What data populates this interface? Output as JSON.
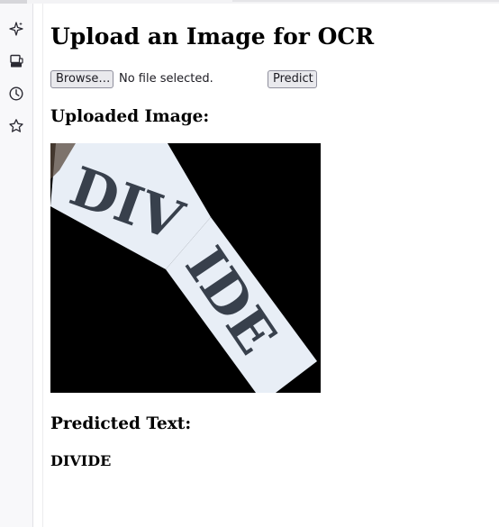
{
  "page": {
    "title": "Upload an Image for OCR"
  },
  "file_input": {
    "browse_label": "Browse…",
    "status_text": "No file selected."
  },
  "predict_button": {
    "label": "Predict"
  },
  "uploaded_section": {
    "heading": "Uploaded Image:",
    "image_word": "DIVIDE"
  },
  "predicted_section": {
    "heading": "Predicted Text:",
    "value": "DIVIDE"
  },
  "sidebar": {
    "icons": [
      "sparkle-icon",
      "synced-tabs-icon",
      "history-icon",
      "bookmark-star-icon"
    ]
  },
  "colors": {
    "image_background": "#000000",
    "paper": "#e8eef6",
    "ink": "#38404c",
    "sidebar_icon": "#2b2a33"
  }
}
